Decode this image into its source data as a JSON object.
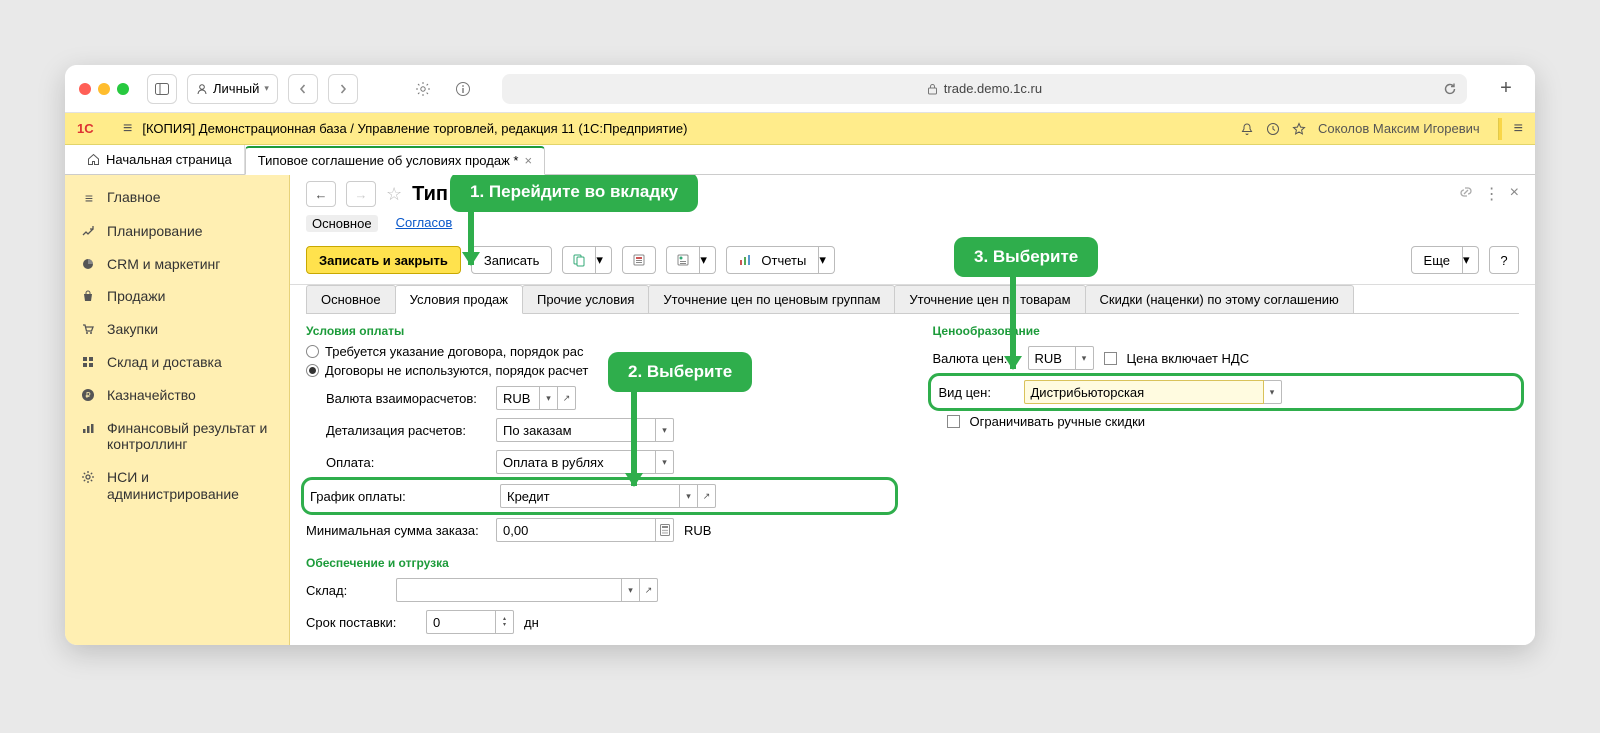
{
  "browser": {
    "profile": "Личный",
    "url": "trade.demo.1c.ru"
  },
  "yellowbar": {
    "title": "[КОПИЯ] Демонстрационная база / Управление торговлей, редакция 11  (1С:Предприятие)",
    "user": "Соколов Максим Игоревич"
  },
  "wtabs": {
    "home": "Начальная страница",
    "active": "Типовое соглашение об условиях продаж *"
  },
  "sidebar": [
    "Главное",
    "Планирование",
    "CRM и маркетинг",
    "Продажи",
    "Закупки",
    "Склад и доставка",
    "Казначейство",
    "Финансовый результат и контроллинг",
    "НСИ и администрирование"
  ],
  "header": {
    "title": "Тип",
    "title_suffix": " *"
  },
  "subnav": {
    "main": "Основное",
    "link1": "Согласов"
  },
  "toolbar": {
    "saveclose": "Записать и закрыть",
    "save": "Записать",
    "reports": "Отчеты",
    "more": "Еще",
    "help": "?"
  },
  "itabs": [
    "Основное",
    "Условия продаж",
    "Прочие условия",
    "Уточнение цен по ценовым группам",
    "Уточнение цен по товарам",
    "Скидки (наценки) по этому соглашению"
  ],
  "left": {
    "group1": "Условия оплаты",
    "radio1": "Требуется указание договора, порядок рас",
    "radio2": "Договоры не используются, порядок расчет",
    "currency_label": "Валюта взаиморасчетов:",
    "currency": "RUB",
    "detail_label": "Детализация расчетов:",
    "detail": "По заказам",
    "payment_label": "Оплата:",
    "payment": "Оплата в рублях",
    "schedule_label": "График оплаты:",
    "schedule": "Кредит",
    "min_label": "Минимальная сумма заказа:",
    "min_val": "0,00",
    "min_cur": "RUB",
    "group2": "Обеспечение и отгрузка",
    "store_label": "Склад:",
    "leadtime_label": "Срок поставки:",
    "leadtime_val": "0",
    "leadtime_unit": "дн"
  },
  "right": {
    "group": "Ценообразование",
    "pricecur_label": "Валюта цен:",
    "pricecur": "RUB",
    "vat_label": "Цена включает НДС",
    "pricetype_label": "Вид цен:",
    "pricetype": "Дистрибьюторская",
    "limit_label": "Ограничивать ручные скидки"
  },
  "callouts": {
    "c1": "1. Перейдите во вкладку",
    "c2": "2. Выберите",
    "c3": "3. Выберите"
  }
}
